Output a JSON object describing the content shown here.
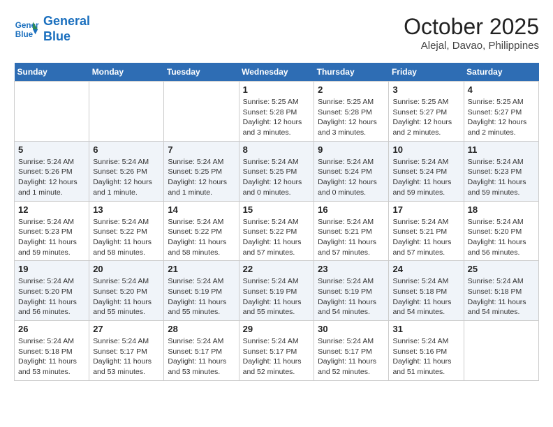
{
  "logo": {
    "line1": "General",
    "line2": "Blue"
  },
  "title": "October 2025",
  "location": "Alejal, Davao, Philippines",
  "weekdays": [
    "Sunday",
    "Monday",
    "Tuesday",
    "Wednesday",
    "Thursday",
    "Friday",
    "Saturday"
  ],
  "weeks": [
    [
      {
        "day": "",
        "info": ""
      },
      {
        "day": "",
        "info": ""
      },
      {
        "day": "",
        "info": ""
      },
      {
        "day": "1",
        "info": "Sunrise: 5:25 AM\nSunset: 5:28 PM\nDaylight: 12 hours and 3 minutes."
      },
      {
        "day": "2",
        "info": "Sunrise: 5:25 AM\nSunset: 5:28 PM\nDaylight: 12 hours and 3 minutes."
      },
      {
        "day": "3",
        "info": "Sunrise: 5:25 AM\nSunset: 5:27 PM\nDaylight: 12 hours and 2 minutes."
      },
      {
        "day": "4",
        "info": "Sunrise: 5:25 AM\nSunset: 5:27 PM\nDaylight: 12 hours and 2 minutes."
      }
    ],
    [
      {
        "day": "5",
        "info": "Sunrise: 5:24 AM\nSunset: 5:26 PM\nDaylight: 12 hours and 1 minute."
      },
      {
        "day": "6",
        "info": "Sunrise: 5:24 AM\nSunset: 5:26 PM\nDaylight: 12 hours and 1 minute."
      },
      {
        "day": "7",
        "info": "Sunrise: 5:24 AM\nSunset: 5:25 PM\nDaylight: 12 hours and 1 minute."
      },
      {
        "day": "8",
        "info": "Sunrise: 5:24 AM\nSunset: 5:25 PM\nDaylight: 12 hours and 0 minutes."
      },
      {
        "day": "9",
        "info": "Sunrise: 5:24 AM\nSunset: 5:24 PM\nDaylight: 12 hours and 0 minutes."
      },
      {
        "day": "10",
        "info": "Sunrise: 5:24 AM\nSunset: 5:24 PM\nDaylight: 11 hours and 59 minutes."
      },
      {
        "day": "11",
        "info": "Sunrise: 5:24 AM\nSunset: 5:23 PM\nDaylight: 11 hours and 59 minutes."
      }
    ],
    [
      {
        "day": "12",
        "info": "Sunrise: 5:24 AM\nSunset: 5:23 PM\nDaylight: 11 hours and 59 minutes."
      },
      {
        "day": "13",
        "info": "Sunrise: 5:24 AM\nSunset: 5:22 PM\nDaylight: 11 hours and 58 minutes."
      },
      {
        "day": "14",
        "info": "Sunrise: 5:24 AM\nSunset: 5:22 PM\nDaylight: 11 hours and 58 minutes."
      },
      {
        "day": "15",
        "info": "Sunrise: 5:24 AM\nSunset: 5:22 PM\nDaylight: 11 hours and 57 minutes."
      },
      {
        "day": "16",
        "info": "Sunrise: 5:24 AM\nSunset: 5:21 PM\nDaylight: 11 hours and 57 minutes."
      },
      {
        "day": "17",
        "info": "Sunrise: 5:24 AM\nSunset: 5:21 PM\nDaylight: 11 hours and 57 minutes."
      },
      {
        "day": "18",
        "info": "Sunrise: 5:24 AM\nSunset: 5:20 PM\nDaylight: 11 hours and 56 minutes."
      }
    ],
    [
      {
        "day": "19",
        "info": "Sunrise: 5:24 AM\nSunset: 5:20 PM\nDaylight: 11 hours and 56 minutes."
      },
      {
        "day": "20",
        "info": "Sunrise: 5:24 AM\nSunset: 5:20 PM\nDaylight: 11 hours and 55 minutes."
      },
      {
        "day": "21",
        "info": "Sunrise: 5:24 AM\nSunset: 5:19 PM\nDaylight: 11 hours and 55 minutes."
      },
      {
        "day": "22",
        "info": "Sunrise: 5:24 AM\nSunset: 5:19 PM\nDaylight: 11 hours and 55 minutes."
      },
      {
        "day": "23",
        "info": "Sunrise: 5:24 AM\nSunset: 5:19 PM\nDaylight: 11 hours and 54 minutes."
      },
      {
        "day": "24",
        "info": "Sunrise: 5:24 AM\nSunset: 5:18 PM\nDaylight: 11 hours and 54 minutes."
      },
      {
        "day": "25",
        "info": "Sunrise: 5:24 AM\nSunset: 5:18 PM\nDaylight: 11 hours and 54 minutes."
      }
    ],
    [
      {
        "day": "26",
        "info": "Sunrise: 5:24 AM\nSunset: 5:18 PM\nDaylight: 11 hours and 53 minutes."
      },
      {
        "day": "27",
        "info": "Sunrise: 5:24 AM\nSunset: 5:17 PM\nDaylight: 11 hours and 53 minutes."
      },
      {
        "day": "28",
        "info": "Sunrise: 5:24 AM\nSunset: 5:17 PM\nDaylight: 11 hours and 53 minutes."
      },
      {
        "day": "29",
        "info": "Sunrise: 5:24 AM\nSunset: 5:17 PM\nDaylight: 11 hours and 52 minutes."
      },
      {
        "day": "30",
        "info": "Sunrise: 5:24 AM\nSunset: 5:17 PM\nDaylight: 11 hours and 52 minutes."
      },
      {
        "day": "31",
        "info": "Sunrise: 5:24 AM\nSunset: 5:16 PM\nDaylight: 11 hours and 51 minutes."
      },
      {
        "day": "",
        "info": ""
      }
    ]
  ]
}
